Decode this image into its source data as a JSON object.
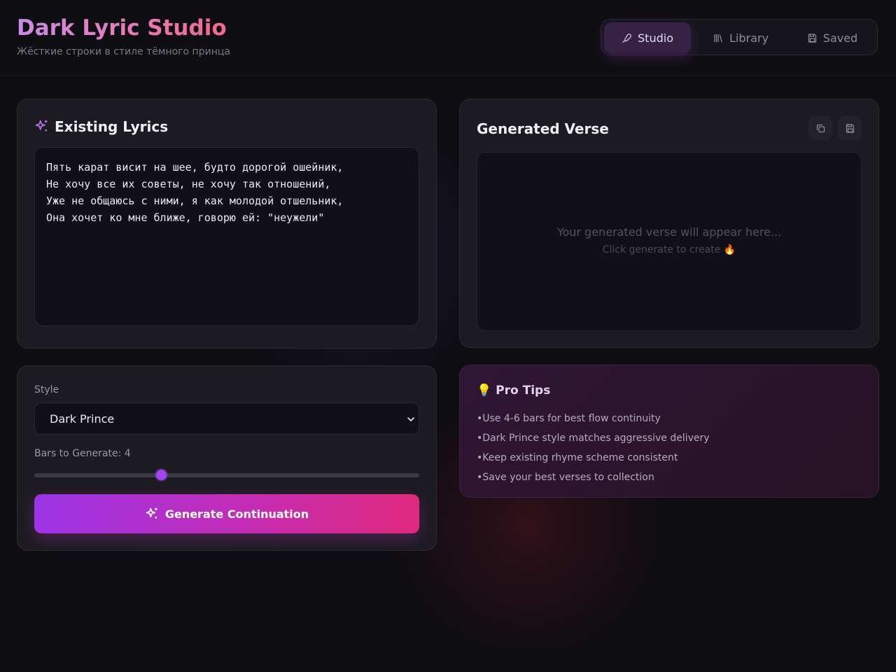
{
  "app": {
    "title": "Dark Lyric Studio",
    "subtitle": "Жёсткие строки в стиле тёмного принца"
  },
  "nav": {
    "active": "Studio",
    "items": [
      {
        "label": "Studio",
        "icon": "microphone-icon"
      },
      {
        "label": "Library",
        "icon": "library-icon"
      },
      {
        "label": "Saved",
        "icon": "floppy-disk-icon"
      }
    ]
  },
  "lyrics_panel": {
    "title": "Existing Lyrics",
    "icon": "sparkles-icon",
    "text": "Пять карат висит на шее, будто дорогой ошейник,\nНе хочу все их советы, не хочу так отношений,\nУже не общаюсь с ними, я как молодой отшельник,\nОна хочет ко мне ближе, говорю ей: \"неужели\""
  },
  "verse_panel": {
    "title": "Generated Verse",
    "actions": [
      "copy-icon",
      "save-icon"
    ],
    "placeholder": "Your generated verse will appear here...",
    "hint": "Click generate to create 🔥"
  },
  "controls": {
    "style_label": "Style",
    "style_value": "Dark Prince",
    "bars_label": "Bars to Generate: 4",
    "bars_value": 4,
    "bars_fraction": 0.33,
    "generate_label": "Generate Continuation"
  },
  "tips": {
    "title": "Pro Tips",
    "icon": "💡",
    "items": [
      "Use 4-6 bars for best flow continuity",
      "Dark Prince style matches aggressive delivery",
      "Keep existing rhyme scheme consistent",
      "Save your best verses to collection"
    ]
  },
  "colors": {
    "background": "#0f0e13",
    "accent_purple": "#9b34e6",
    "accent_pink": "#e02a7d",
    "card": "#1e1c24"
  }
}
